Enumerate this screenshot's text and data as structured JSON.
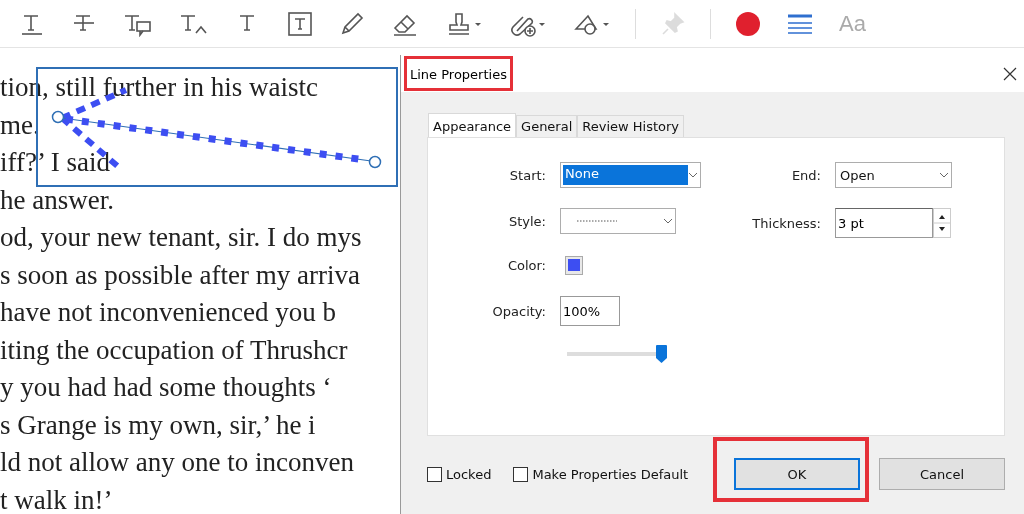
{
  "toolbar": {
    "tools": [
      {
        "kind": "underline",
        "disabled": false
      },
      {
        "kind": "strikethrough",
        "disabled": false
      },
      {
        "kind": "text-comment",
        "disabled": false
      },
      {
        "kind": "insert-text",
        "disabled": false
      },
      {
        "kind": "text",
        "disabled": false
      },
      {
        "kind": "text-box",
        "disabled": false
      },
      {
        "kind": "pencil",
        "disabled": false
      },
      {
        "kind": "eraser",
        "disabled": false
      },
      {
        "kind": "stamp",
        "disabled": false
      },
      {
        "kind": "attach",
        "disabled": false
      },
      {
        "kind": "shapes",
        "disabled": false
      },
      {
        "kind": "pin",
        "disabled": true
      },
      {
        "kind": "color",
        "disabled": false
      },
      {
        "kind": "line-weight",
        "disabled": false
      },
      {
        "kind": "font",
        "label": "Aa",
        "disabled": false
      }
    ]
  },
  "document": {
    "lines": [
      "tion, still further in his waistc",
      "me.",
      "iff?’ I said",
      "he answer.",
      "od, your new tenant, sir. I do mys",
      "s soon as possible after my arriva",
      "have not inconvenienced you b",
      "iting the occupation of Thrushcr",
      "y you had had some thoughts ‘",
      "s Grange is my own, sir,’ he i",
      "ld not allow any one to inconven",
      "t walk in!’"
    ],
    "line_annotation": {
      "selected": true
    }
  },
  "dialog": {
    "title": "Line Properties",
    "title_highlighted": true,
    "tabs": [
      {
        "label": "Appearance",
        "selected": true
      },
      {
        "label": "General",
        "selected": false
      },
      {
        "label": "Review History",
        "selected": false
      }
    ],
    "left_fields": [
      {
        "kind": "select",
        "label": "Start:",
        "value": "None",
        "selected": true
      },
      {
        "kind": "line-style",
        "label": "Style:"
      },
      {
        "kind": "color",
        "label": "Color:",
        "color": "#3d4ef2"
      },
      {
        "kind": "input",
        "label": "Opacity:",
        "value": "100%"
      },
      {
        "kind": "slider",
        "level": 1
      }
    ],
    "right_fields": [
      {
        "kind": "select",
        "label": "End:",
        "value": "Open",
        "selected": false
      },
      {
        "kind": "spin",
        "label": "Thickness:",
        "value": "3 pt"
      }
    ],
    "checkboxes": [
      {
        "label": "Locked",
        "checked": false
      },
      {
        "label": "Make Properties Default",
        "checked": false
      }
    ],
    "buttons": [
      {
        "label": "OK",
        "focused": true,
        "highlighted": true
      },
      {
        "label": "Cancel",
        "focused": false,
        "highlighted": false
      }
    ]
  }
}
